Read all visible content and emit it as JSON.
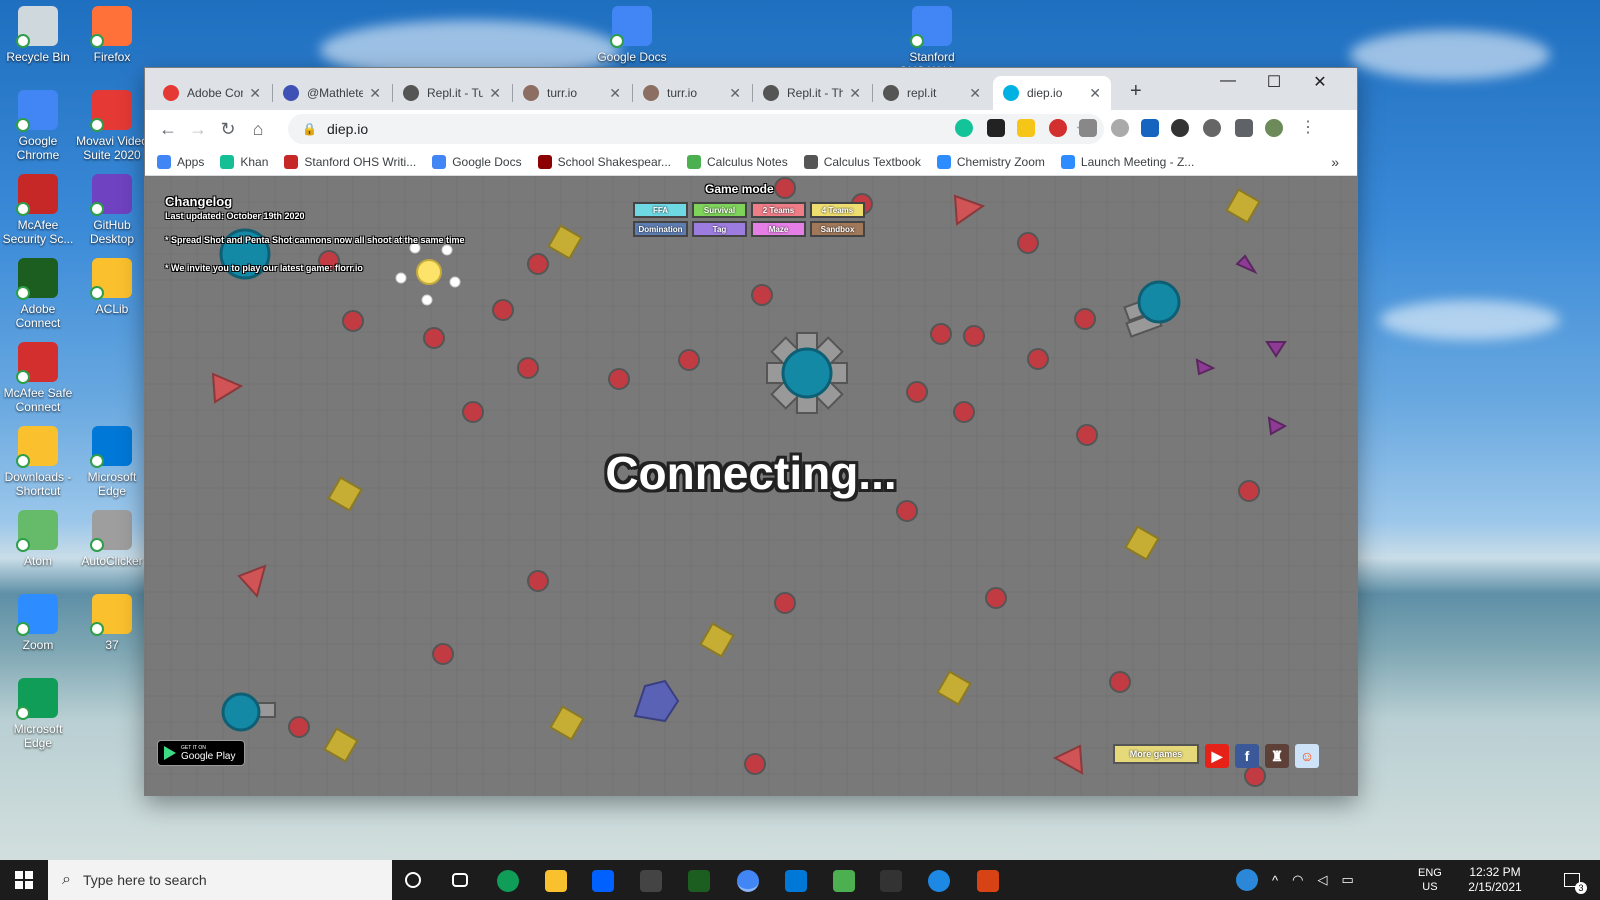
{
  "desktop": {
    "icons": [
      {
        "label": "Recycle Bin",
        "color": "#cfd8dc"
      },
      {
        "label": "Firefox",
        "color": "#ff7139"
      },
      {
        "label": "Google Chrome",
        "color": "#4285f4"
      },
      {
        "label": "Movavi Video Suite 2020",
        "color": "#e53935"
      },
      {
        "label": "McAfee Security Sc...",
        "color": "#c62828"
      },
      {
        "label": "GitHub Desktop",
        "color": "#6f42c1"
      },
      {
        "label": "Adobe Connect",
        "color": "#1b5e20"
      },
      {
        "label": "ACLib",
        "color": "#fbc02d"
      },
      {
        "label": "McAfee Safe Connect",
        "color": "#d32f2f"
      },
      {
        "label": "Downloads - Shortcut",
        "color": "#fbc02d"
      },
      {
        "label": "Microsoft Edge",
        "color": "#0078d7"
      },
      {
        "label": "Atom",
        "color": "#66bb6a"
      },
      {
        "label": "AutoClicker",
        "color": "#9e9e9e"
      },
      {
        "label": "Zoom",
        "color": "#2d8cff"
      },
      {
        "label": "37",
        "color": "#fbc02d"
      },
      {
        "label": "Microsoft Edge",
        "color": "#0f9d58"
      },
      {
        "label": "Google Docs",
        "color": "#4285f4"
      },
      {
        "label": "Stanford OHS Writing & T...",
        "color": "#4285f4"
      }
    ]
  },
  "browser": {
    "tabs": [
      {
        "title": "Adobe Con",
        "color": "#e53935"
      },
      {
        "title": "@Mathlete",
        "color": "#3f51b5"
      },
      {
        "title": "Repl.it - Tu",
        "color": "#555555"
      },
      {
        "title": "turr.io",
        "color": "#8d6e63"
      },
      {
        "title": "turr.io",
        "color": "#8d6e63"
      },
      {
        "title": "Repl.it - Th",
        "color": "#555555"
      },
      {
        "title": "repl.it",
        "color": "#555555"
      },
      {
        "title": "diep.io",
        "color": "#00b2e1"
      }
    ],
    "new_tab": "+",
    "controls": {
      "minimize": "—",
      "maximize": "☐",
      "close": "✕"
    },
    "url": "diep.io",
    "bookmarks": [
      {
        "label": "Apps",
        "color": "#4285f4"
      },
      {
        "label": "Khan",
        "color": "#14bf96"
      },
      {
        "label": "Stanford OHS Writi...",
        "color": "#c62828"
      },
      {
        "label": "Google Docs",
        "color": "#4285f4"
      },
      {
        "label": "School Shakespear...",
        "color": "#8b0000"
      },
      {
        "label": "Calculus Notes",
        "color": "#4caf50"
      },
      {
        "label": "Calculus Textbook",
        "color": "#555555"
      },
      {
        "label": "Chemistry Zoom",
        "color": "#2d8cff"
      },
      {
        "label": "Launch Meeting - Z...",
        "color": "#2d8cff"
      }
    ],
    "bookmarks_overflow": "»"
  },
  "game": {
    "changelog": {
      "title": "Changelog",
      "updated": "Last updated: October 19th 2020",
      "lines": [
        "* Spread Shot and Penta Shot cannons now all shoot at the same time",
        "* We invite you to play our latest game: florr.io"
      ]
    },
    "game_mode": {
      "title": "Game mode",
      "modes": [
        {
          "label": "FFA",
          "color": "#6ed8e3"
        },
        {
          "label": "Survival",
          "color": "#7fd35a"
        },
        {
          "label": "2 Teams",
          "color": "#ef7d88"
        },
        {
          "label": "4 Teams",
          "color": "#eedd6f"
        },
        {
          "label": "Domination",
          "color": "#5e7eb3"
        },
        {
          "label": "Tag",
          "color": "#9d7ce0"
        },
        {
          "label": "Maze",
          "color": "#e57fe5"
        },
        {
          "label": "Sandbox",
          "color": "#a0785a"
        }
      ]
    },
    "status": "Connecting...",
    "google_play": {
      "small": "GET IT ON",
      "big": "Google Play"
    },
    "more_games": "More games",
    "colors": {
      "background": "#797979",
      "bullet": "#c33b42",
      "square": "#c6ad33",
      "triangle": "#d05356",
      "small_triangle": "#8e3b95",
      "pentagon": "#5962b5",
      "tank": "#1389a6"
    }
  },
  "taskbar": {
    "search_placeholder": "Type here to search",
    "lang": "ENG",
    "region": "US",
    "time": "12:32 PM",
    "date": "2/15/2021",
    "notifications": "3"
  }
}
